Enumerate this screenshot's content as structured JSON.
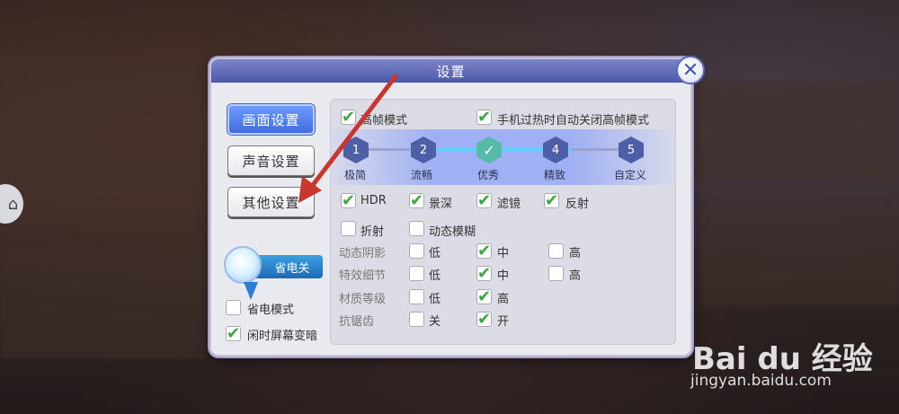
{
  "dialog": {
    "title": "设置",
    "close_icon": "close-x-icon"
  },
  "nav": {
    "items": [
      {
        "label": "画面设置",
        "active": true
      },
      {
        "label": "声音设置",
        "active": false
      },
      {
        "label": "其他设置",
        "active": false
      }
    ]
  },
  "power": {
    "badge_label": "省电关",
    "options": [
      {
        "label": "省电模式",
        "checked": false
      },
      {
        "label": "闲时屏幕变暗",
        "checked": true
      }
    ]
  },
  "graphics": {
    "top_options": [
      {
        "label": "高帧模式",
        "checked": true
      },
      {
        "label": "手机过热时自动关闭高帧模式",
        "checked": true
      }
    ],
    "presets": [
      {
        "num": "1",
        "label": "极简",
        "active": false
      },
      {
        "num": "2",
        "label": "流畅",
        "active": false
      },
      {
        "num": "✓",
        "label": "优秀",
        "active": true
      },
      {
        "num": "4",
        "label": "精致",
        "active": false
      },
      {
        "num": "5",
        "label": "自定义",
        "active": false
      }
    ],
    "effects_row1": [
      {
        "label": "HDR",
        "checked": true
      },
      {
        "label": "景深",
        "checked": true
      },
      {
        "label": "滤镜",
        "checked": true
      },
      {
        "label": "反射",
        "checked": true
      }
    ],
    "effects_row2": [
      {
        "label": "折射",
        "checked": false
      },
      {
        "label": "动态模糊",
        "checked": false
      }
    ],
    "quality_rows": [
      {
        "label": "动态阴影",
        "options": [
          {
            "label": "低",
            "checked": false
          },
          {
            "label": "中",
            "checked": true
          },
          {
            "label": "高",
            "checked": false
          }
        ]
      },
      {
        "label": "特效细节",
        "options": [
          {
            "label": "低",
            "checked": false
          },
          {
            "label": "中",
            "checked": true
          },
          {
            "label": "高",
            "checked": false
          }
        ]
      },
      {
        "label": "材质等级",
        "options": [
          {
            "label": "低",
            "checked": false
          },
          {
            "label": "高",
            "checked": true
          }
        ]
      },
      {
        "label": "抗锯齿",
        "options": [
          {
            "label": "关",
            "checked": false
          },
          {
            "label": "开",
            "checked": true
          }
        ]
      }
    ]
  },
  "watermark": {
    "logo": "Bai du 经验",
    "url": "jingyan.baidu.com"
  },
  "colors": {
    "accent": "#3e6de0",
    "check": "#3aa83a",
    "arrow": "#c8372d"
  }
}
